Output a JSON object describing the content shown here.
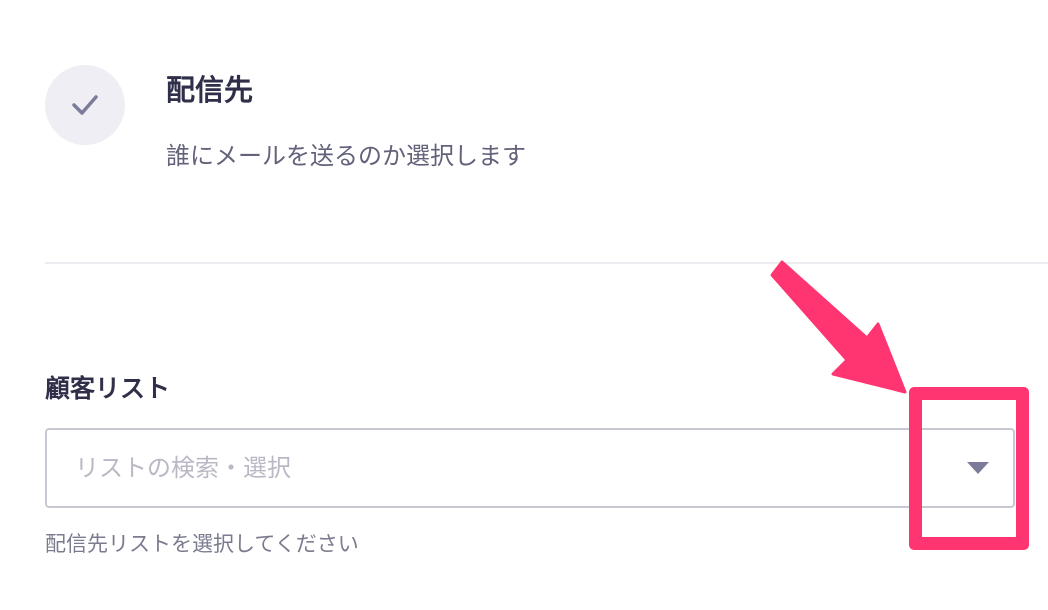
{
  "step": {
    "icon": "check-icon",
    "title": "配信先",
    "description": "誰にメールを送るのか選択します"
  },
  "customer_list": {
    "label": "顧客リスト",
    "placeholder": "リストの検索・選択",
    "value": "",
    "helper": "配信先リストを選択してください",
    "toggle_icon": "caret-down-icon"
  },
  "annotation": {
    "color": "#ff3572",
    "arrow_icon": "pointer-arrow-icon"
  },
  "colors": {
    "title": "#2f2f4a",
    "muted": "#62627a",
    "placeholder": "#b9b9c6",
    "border": "#c8c8d2",
    "icon_bg": "#eeeef4",
    "icon_fg": "#7c7c9a"
  }
}
